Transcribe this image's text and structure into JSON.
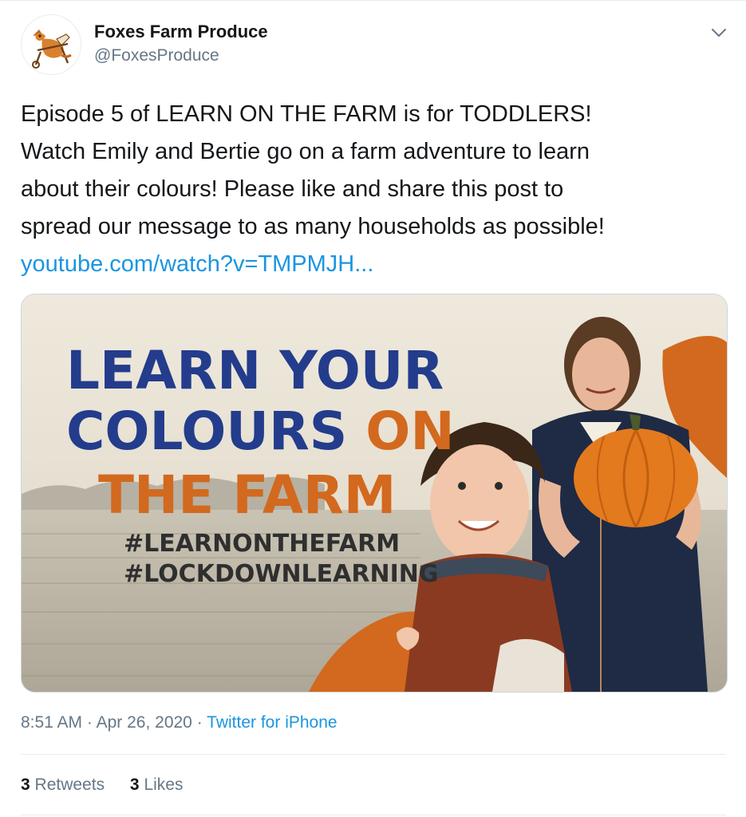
{
  "account": {
    "display_name": "Foxes Farm Produce",
    "handle": "@FoxesProduce",
    "avatar_icon": "fox-logo-icon"
  },
  "tweet": {
    "lines": [
      "Episode 5 of LEARN ON THE FARM is for TODDLERS!",
      "Watch Emily and Bertie go on a farm adventure to learn",
      "about their colours!  Please like and share this post to",
      "spread our message to as many households as possible!"
    ],
    "link": "youtube.com/watch?v=TMPMJH..."
  },
  "media": {
    "title_line1": "LEARN YOUR",
    "title_line2_a": "COLOURS ",
    "title_line2_b": "ON",
    "title_line3": "THE FARM",
    "hashtag1": "#LEARNONTHEFARM",
    "hashtag2": "#LOCKDOWNLEARNING",
    "colors": {
      "blue": "#233c8c",
      "orange": "#d2691e"
    }
  },
  "meta": {
    "time": "8:51 AM",
    "sep": "·",
    "date": "Apr 26, 2020",
    "source": "Twitter for iPhone"
  },
  "stats": {
    "retweets_count": "3",
    "retweets_label": "Retweets",
    "likes_count": "3",
    "likes_label": "Likes"
  },
  "colors": {
    "link": "#1b95e0",
    "secondary_text": "#657786",
    "border": "#e6ecf0"
  }
}
